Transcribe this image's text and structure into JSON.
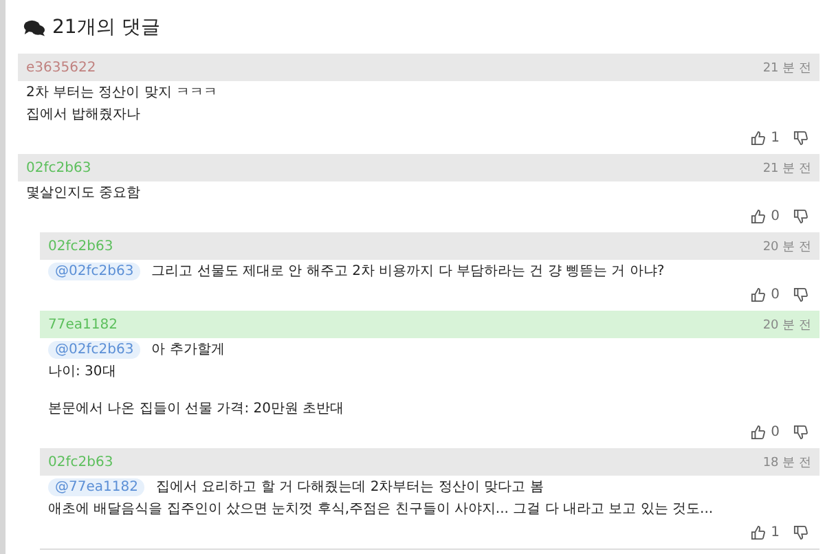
{
  "title": "21개의 댓글",
  "comments": [
    {
      "author": "e3635622",
      "color": "#c0817f",
      "time": "21 분 전",
      "highlighted": false,
      "paragraphs": [
        [
          "2차 부터는 정산이 맞지 ㅋㅋㅋ",
          "집에서 밥해줬자나"
        ]
      ],
      "likes": "1"
    },
    {
      "author": "02fc2b63",
      "color": "#5cbf5c",
      "time": "21 분 전",
      "highlighted": false,
      "paragraphs": [
        [
          "몇살인지도 중요함"
        ]
      ],
      "likes": "0",
      "children": [
        {
          "author": "02fc2b63",
          "color": "#5cbf5c",
          "time": "20 분 전",
          "highlighted": false,
          "mention": "@02fc2b63",
          "paragraphs": [
            [
              "그리고 선물도 제대로 안 해주고 2차 비용까지 다 부담하라는 건 걍 삥뜯는 거 아냐?"
            ]
          ],
          "likes": "0"
        },
        {
          "author": "77ea1182",
          "color": "#5cbf5c",
          "time": "20 분 전",
          "highlighted": true,
          "mention": "@02fc2b63",
          "paragraphs": [
            [
              "아 추가할게",
              "나이: 30대"
            ],
            [
              "본문에서 나온 집들이 선물 가격: 20만원 초반대"
            ]
          ],
          "likes": "0"
        },
        {
          "author": "02fc2b63",
          "color": "#5cbf5c",
          "time": "18 분 전",
          "highlighted": false,
          "mention": "@77ea1182",
          "paragraphs": [
            [
              "집에서 요리하고 할 거 다해줬는데 2차부터는 정산이 맞다고 봄",
              "애초에 배달음식을 집주인이 샀으면 눈치껏 후식,주점은 친구들이 사야지... 그걸 다 내라고 보고 있는 것도..."
            ]
          ],
          "likes": "1"
        }
      ]
    }
  ]
}
